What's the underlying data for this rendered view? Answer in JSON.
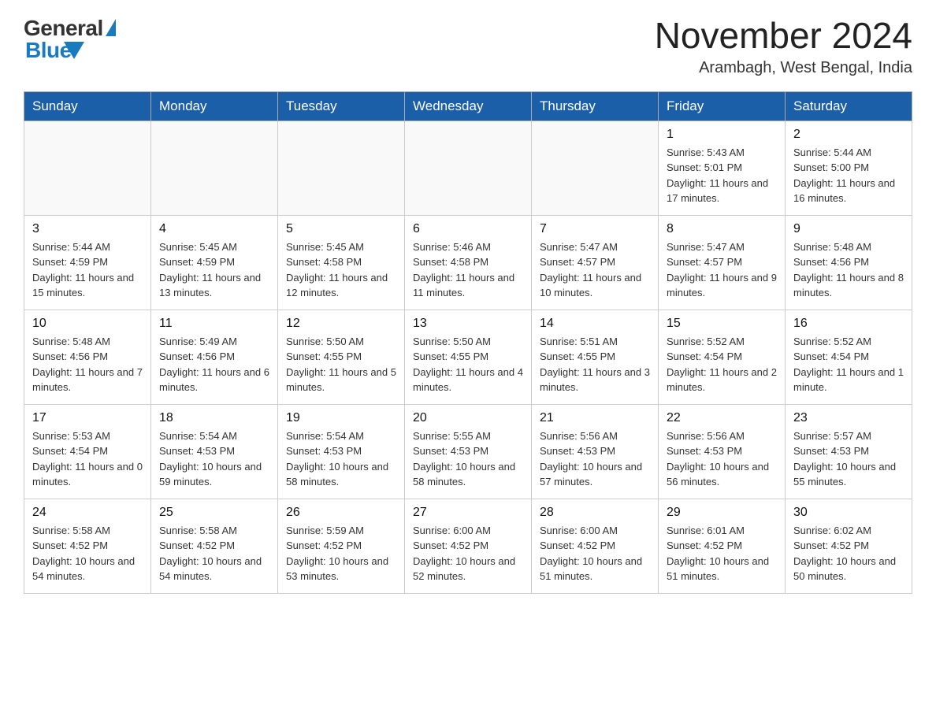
{
  "header": {
    "logo_general": "General",
    "logo_blue": "Blue",
    "title": "November 2024",
    "subtitle": "Arambagh, West Bengal, India"
  },
  "days_of_week": [
    "Sunday",
    "Monday",
    "Tuesday",
    "Wednesday",
    "Thursday",
    "Friday",
    "Saturday"
  ],
  "weeks": [
    [
      {
        "day": "",
        "info": ""
      },
      {
        "day": "",
        "info": ""
      },
      {
        "day": "",
        "info": ""
      },
      {
        "day": "",
        "info": ""
      },
      {
        "day": "",
        "info": ""
      },
      {
        "day": "1",
        "info": "Sunrise: 5:43 AM\nSunset: 5:01 PM\nDaylight: 11 hours and 17 minutes."
      },
      {
        "day": "2",
        "info": "Sunrise: 5:44 AM\nSunset: 5:00 PM\nDaylight: 11 hours and 16 minutes."
      }
    ],
    [
      {
        "day": "3",
        "info": "Sunrise: 5:44 AM\nSunset: 4:59 PM\nDaylight: 11 hours and 15 minutes."
      },
      {
        "day": "4",
        "info": "Sunrise: 5:45 AM\nSunset: 4:59 PM\nDaylight: 11 hours and 13 minutes."
      },
      {
        "day": "5",
        "info": "Sunrise: 5:45 AM\nSunset: 4:58 PM\nDaylight: 11 hours and 12 minutes."
      },
      {
        "day": "6",
        "info": "Sunrise: 5:46 AM\nSunset: 4:58 PM\nDaylight: 11 hours and 11 minutes."
      },
      {
        "day": "7",
        "info": "Sunrise: 5:47 AM\nSunset: 4:57 PM\nDaylight: 11 hours and 10 minutes."
      },
      {
        "day": "8",
        "info": "Sunrise: 5:47 AM\nSunset: 4:57 PM\nDaylight: 11 hours and 9 minutes."
      },
      {
        "day": "9",
        "info": "Sunrise: 5:48 AM\nSunset: 4:56 PM\nDaylight: 11 hours and 8 minutes."
      }
    ],
    [
      {
        "day": "10",
        "info": "Sunrise: 5:48 AM\nSunset: 4:56 PM\nDaylight: 11 hours and 7 minutes."
      },
      {
        "day": "11",
        "info": "Sunrise: 5:49 AM\nSunset: 4:56 PM\nDaylight: 11 hours and 6 minutes."
      },
      {
        "day": "12",
        "info": "Sunrise: 5:50 AM\nSunset: 4:55 PM\nDaylight: 11 hours and 5 minutes."
      },
      {
        "day": "13",
        "info": "Sunrise: 5:50 AM\nSunset: 4:55 PM\nDaylight: 11 hours and 4 minutes."
      },
      {
        "day": "14",
        "info": "Sunrise: 5:51 AM\nSunset: 4:55 PM\nDaylight: 11 hours and 3 minutes."
      },
      {
        "day": "15",
        "info": "Sunrise: 5:52 AM\nSunset: 4:54 PM\nDaylight: 11 hours and 2 minutes."
      },
      {
        "day": "16",
        "info": "Sunrise: 5:52 AM\nSunset: 4:54 PM\nDaylight: 11 hours and 1 minute."
      }
    ],
    [
      {
        "day": "17",
        "info": "Sunrise: 5:53 AM\nSunset: 4:54 PM\nDaylight: 11 hours and 0 minutes."
      },
      {
        "day": "18",
        "info": "Sunrise: 5:54 AM\nSunset: 4:53 PM\nDaylight: 10 hours and 59 minutes."
      },
      {
        "day": "19",
        "info": "Sunrise: 5:54 AM\nSunset: 4:53 PM\nDaylight: 10 hours and 58 minutes."
      },
      {
        "day": "20",
        "info": "Sunrise: 5:55 AM\nSunset: 4:53 PM\nDaylight: 10 hours and 58 minutes."
      },
      {
        "day": "21",
        "info": "Sunrise: 5:56 AM\nSunset: 4:53 PM\nDaylight: 10 hours and 57 minutes."
      },
      {
        "day": "22",
        "info": "Sunrise: 5:56 AM\nSunset: 4:53 PM\nDaylight: 10 hours and 56 minutes."
      },
      {
        "day": "23",
        "info": "Sunrise: 5:57 AM\nSunset: 4:53 PM\nDaylight: 10 hours and 55 minutes."
      }
    ],
    [
      {
        "day": "24",
        "info": "Sunrise: 5:58 AM\nSunset: 4:52 PM\nDaylight: 10 hours and 54 minutes."
      },
      {
        "day": "25",
        "info": "Sunrise: 5:58 AM\nSunset: 4:52 PM\nDaylight: 10 hours and 54 minutes."
      },
      {
        "day": "26",
        "info": "Sunrise: 5:59 AM\nSunset: 4:52 PM\nDaylight: 10 hours and 53 minutes."
      },
      {
        "day": "27",
        "info": "Sunrise: 6:00 AM\nSunset: 4:52 PM\nDaylight: 10 hours and 52 minutes."
      },
      {
        "day": "28",
        "info": "Sunrise: 6:00 AM\nSunset: 4:52 PM\nDaylight: 10 hours and 51 minutes."
      },
      {
        "day": "29",
        "info": "Sunrise: 6:01 AM\nSunset: 4:52 PM\nDaylight: 10 hours and 51 minutes."
      },
      {
        "day": "30",
        "info": "Sunrise: 6:02 AM\nSunset: 4:52 PM\nDaylight: 10 hours and 50 minutes."
      }
    ]
  ]
}
